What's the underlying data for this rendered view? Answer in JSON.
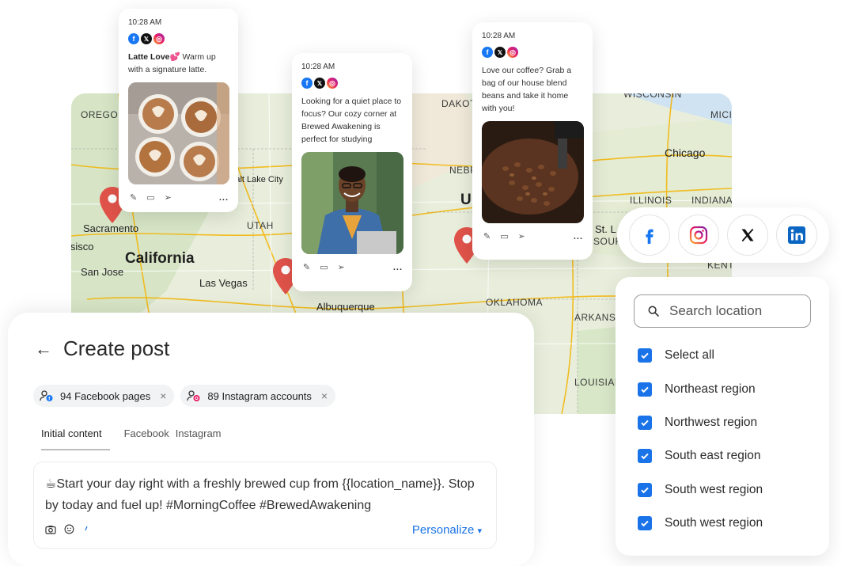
{
  "map": {
    "states": [
      "OREGON",
      "UTAH",
      "NEBR",
      "DAKOT",
      "WISCONSIN",
      "MICI",
      "ILLINOIS",
      "INDIANA",
      "OKLAHOMA",
      "ARKANSA",
      "LOUISIAN",
      "SOUR",
      "KENT"
    ],
    "big_label": "California",
    "cities": [
      "Sacramento",
      "isisco",
      "San Jose",
      "Las Vegas",
      "Salt Lake City",
      "Albuquerque",
      "Chicago",
      "St. L",
      "U"
    ]
  },
  "posts": [
    {
      "time": "10:28 AM",
      "title": "Latte Love",
      "emoji": "💕",
      "body": " Warm up with a signature latte.",
      "image": "latte-art"
    },
    {
      "time": "10:28 AM",
      "body": "Looking for a quiet place to focus? Our cozy corner at Brewed Awakening is perfect for studying",
      "image": "man-with-laptop"
    },
    {
      "time": "10:28 AM",
      "body": "Love our coffee? Grab a bag of our house blend beans and take it home with you!",
      "image": "coffee-beans"
    }
  ],
  "post_actions": {
    "more": "..."
  },
  "social": [
    "facebook",
    "instagram",
    "x",
    "linkedin"
  ],
  "location_panel": {
    "search_placeholder": "Search location",
    "items": [
      {
        "label": "Select all",
        "checked": true
      },
      {
        "label": "Northeast region",
        "checked": true
      },
      {
        "label": "Northwest region",
        "checked": true
      },
      {
        "label": "South east region",
        "checked": true
      },
      {
        "label": "South west region",
        "checked": true
      },
      {
        "label": "South west region",
        "checked": true
      }
    ]
  },
  "create_post": {
    "back": "←",
    "title": "Create post",
    "chips": [
      {
        "label": "94 Facebook pages",
        "remove": "×"
      },
      {
        "label": "89 Instagram accounts",
        "remove": "×"
      }
    ],
    "tabs": [
      "Initial content",
      "Facebook",
      "Instagram"
    ],
    "editor_emoji": "☕",
    "editor_text": "Start your day right with a freshly brewed cup from {{location_name}}. Stop by today and fuel up! #MorningCoffee #BrewedAwakening",
    "personalize_label": "Personalize",
    "personalize_caret": "▾"
  },
  "colors": {
    "accent": "#1a73e8",
    "pin": "#e0534a",
    "facebook": "#1877f2",
    "linkedin": "#0a66c2"
  }
}
